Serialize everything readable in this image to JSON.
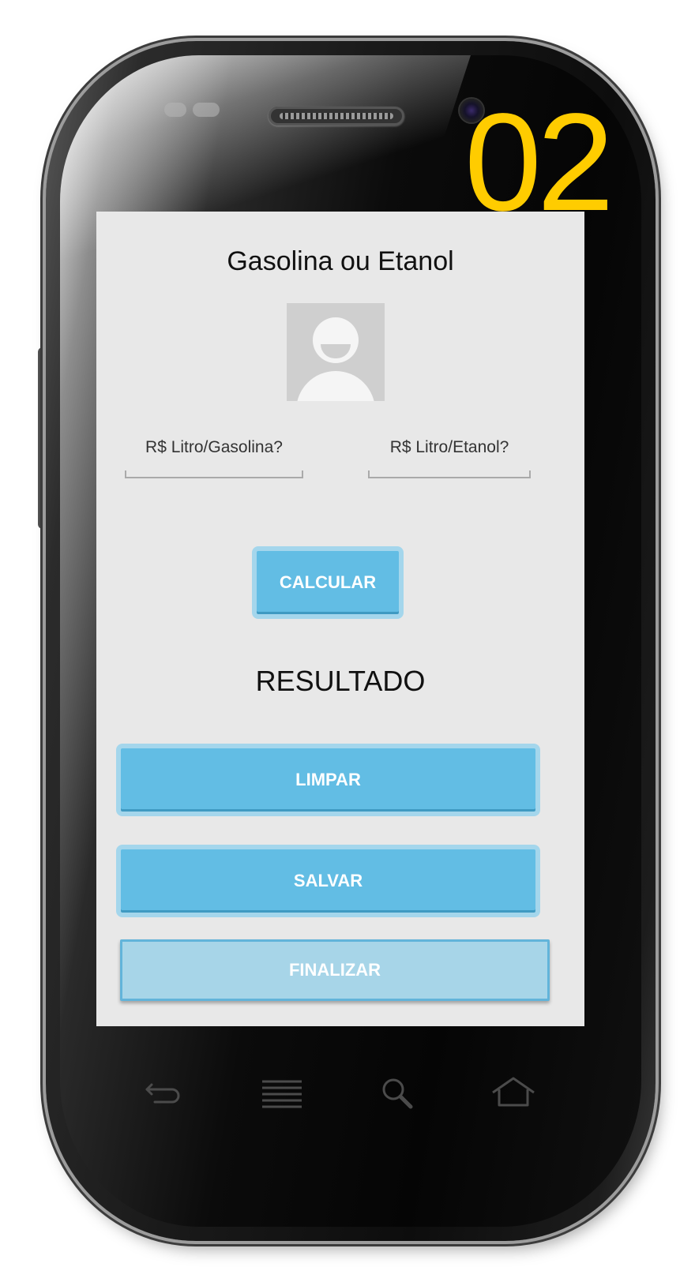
{
  "step_number": "02",
  "app": {
    "title": "Gasolina ou Etanol"
  },
  "inputs": {
    "gasolina_placeholder": "R$ Litro/Gasolina?",
    "etanol_placeholder": "R$ Litro/Etanol?"
  },
  "buttons": {
    "calcular": "CALCULAR",
    "limpar": "LIMPAR",
    "salvar": "SALVAR",
    "finalizar": "FINALIZAR"
  },
  "result": {
    "label": "RESULTADO"
  },
  "nav_keys": [
    "back-icon",
    "menu-icon",
    "search-icon",
    "home-icon"
  ],
  "colors": {
    "accent_button": "#62bde4",
    "button_border": "#a4d6ec",
    "finalizar_button": "#a7d5e8",
    "step_number": "#ffcc00",
    "screen_background": "#e8e8e8"
  }
}
